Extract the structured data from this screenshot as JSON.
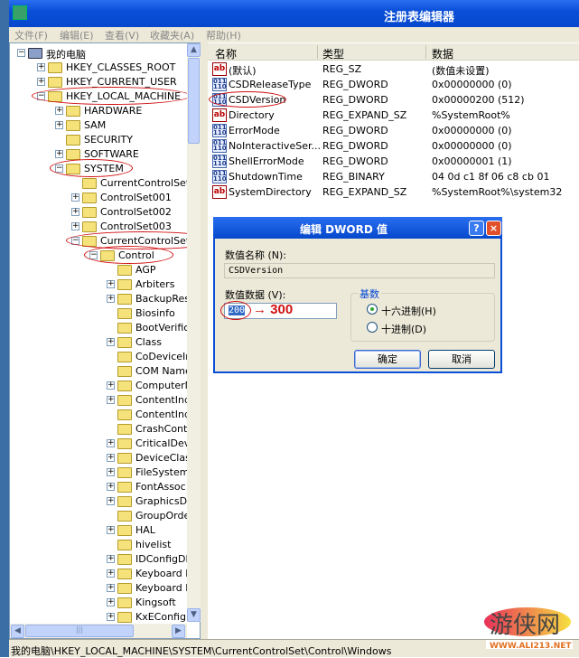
{
  "window": {
    "title": "注册表编辑器"
  },
  "menu": [
    "文件(F)",
    "编辑(E)",
    "查看(V)",
    "收藏夹(A)",
    "帮助(H)"
  ],
  "tree": [
    {
      "label": "我的电脑",
      "depth": 0,
      "exp": "-",
      "icon": "computer"
    },
    {
      "label": "HKEY_CLASSES_ROOT",
      "depth": 1,
      "exp": "+"
    },
    {
      "label": "HKEY_CURRENT_USER",
      "depth": 1,
      "exp": "+"
    },
    {
      "label": "HKEY_LOCAL_MACHINE",
      "depth": 1,
      "exp": "-",
      "circled": true
    },
    {
      "label": "HARDWARE",
      "depth": 2,
      "exp": "+"
    },
    {
      "label": "SAM",
      "depth": 2,
      "exp": "+"
    },
    {
      "label": "SECURITY",
      "depth": 2,
      "exp": ""
    },
    {
      "label": "SOFTWARE",
      "depth": 2,
      "exp": "+"
    },
    {
      "label": "SYSTEM",
      "depth": 2,
      "exp": "-",
      "circled": true
    },
    {
      "label": "CurrentControlSet",
      "depth": 3,
      "exp": ""
    },
    {
      "label": "ControlSet001",
      "depth": 3,
      "exp": "+"
    },
    {
      "label": "ControlSet002",
      "depth": 3,
      "exp": "+"
    },
    {
      "label": "ControlSet003",
      "depth": 3,
      "exp": "+"
    },
    {
      "label": "CurrentControlSet",
      "depth": 3,
      "exp": "-",
      "circled": true
    },
    {
      "label": "Control",
      "depth": 4,
      "exp": "-",
      "circled": true
    },
    {
      "label": "AGP",
      "depth": 5,
      "exp": ""
    },
    {
      "label": "Arbiters",
      "depth": 5,
      "exp": "+"
    },
    {
      "label": "BackupResto",
      "depth": 5,
      "exp": "+"
    },
    {
      "label": "Biosinfo",
      "depth": 5,
      "exp": ""
    },
    {
      "label": "BootVerifica",
      "depth": 5,
      "exp": ""
    },
    {
      "label": "Class",
      "depth": 5,
      "exp": "+"
    },
    {
      "label": "CoDeviceIns",
      "depth": 5,
      "exp": ""
    },
    {
      "label": "COM Name A",
      "depth": 5,
      "exp": ""
    },
    {
      "label": "ComputerNa",
      "depth": 5,
      "exp": "+"
    },
    {
      "label": "ContentInde",
      "depth": 5,
      "exp": "+"
    },
    {
      "label": "ContentInde",
      "depth": 5,
      "exp": ""
    },
    {
      "label": "CrashContro",
      "depth": 5,
      "exp": ""
    },
    {
      "label": "CriticalDevic",
      "depth": 5,
      "exp": "+"
    },
    {
      "label": "DeviceClass",
      "depth": 5,
      "exp": "+"
    },
    {
      "label": "FileSystem",
      "depth": 5,
      "exp": "+"
    },
    {
      "label": "FontAssoc",
      "depth": 5,
      "exp": "+"
    },
    {
      "label": "GraphicsDriv",
      "depth": 5,
      "exp": "+"
    },
    {
      "label": "GroupOrder",
      "depth": 5,
      "exp": ""
    },
    {
      "label": "HAL",
      "depth": 5,
      "exp": "+"
    },
    {
      "label": "hivelist",
      "depth": 5,
      "exp": ""
    },
    {
      "label": "IDConfigDB",
      "depth": 5,
      "exp": "+"
    },
    {
      "label": "Keyboard La",
      "depth": 5,
      "exp": "+"
    },
    {
      "label": "Keyboard La",
      "depth": 5,
      "exp": "+"
    },
    {
      "label": "Kingsoft",
      "depth": 5,
      "exp": "+"
    },
    {
      "label": "KxEConfig",
      "depth": 5,
      "exp": "+"
    }
  ],
  "list": {
    "headers": {
      "name": "名称",
      "type": "类型",
      "data": "数据"
    },
    "rows": [
      {
        "name": "(默认)",
        "type": "REG_SZ",
        "data": "(数值未设置)",
        "icon": "string"
      },
      {
        "name": "CSDReleaseType",
        "type": "REG_DWORD",
        "data": "0x00000000 (0)",
        "icon": "binary"
      },
      {
        "name": "CSDVersion",
        "type": "REG_DWORD",
        "data": "0x00000200 (512)",
        "icon": "binary",
        "circled": true
      },
      {
        "name": "Directory",
        "type": "REG_EXPAND_SZ",
        "data": "%SystemRoot%",
        "icon": "string"
      },
      {
        "name": "ErrorMode",
        "type": "REG_DWORD",
        "data": "0x00000000 (0)",
        "icon": "binary"
      },
      {
        "name": "NoInteractiveSer...",
        "type": "REG_DWORD",
        "data": "0x00000000 (0)",
        "icon": "binary"
      },
      {
        "name": "ShellErrorMode",
        "type": "REG_DWORD",
        "data": "0x00000001 (1)",
        "icon": "binary"
      },
      {
        "name": "ShutdownTime",
        "type": "REG_BINARY",
        "data": "04 0d c1 8f 06 c8 cb 01",
        "icon": "binary"
      },
      {
        "name": "SystemDirectory",
        "type": "REG_EXPAND_SZ",
        "data": "%SystemRoot%\\system32",
        "icon": "string"
      }
    ]
  },
  "dialog": {
    "title": "编辑 DWORD 值",
    "name_label": "数值名称 (N):",
    "name_value": "CSDVersion",
    "data_label": "数值数据 (V):",
    "data_value": "200",
    "annotation": "→ 300",
    "base_label": "基数",
    "radio_hex": "十六进制(H)",
    "radio_dec": "十进制(D)",
    "selected_base": "hex",
    "ok": "确定",
    "cancel": "取消",
    "help": "?",
    "close": "×"
  },
  "status": "我的电脑\\HKEY_LOCAL_MACHINE\\SYSTEM\\CurrentControlSet\\Control\\Windows",
  "watermark": {
    "text": "游侠网",
    "url": "WWW.ALI213.NET"
  },
  "colors": {
    "titlebar": "#0a4fd8",
    "annotation": "#d01010",
    "folder": "#f5e27a"
  }
}
